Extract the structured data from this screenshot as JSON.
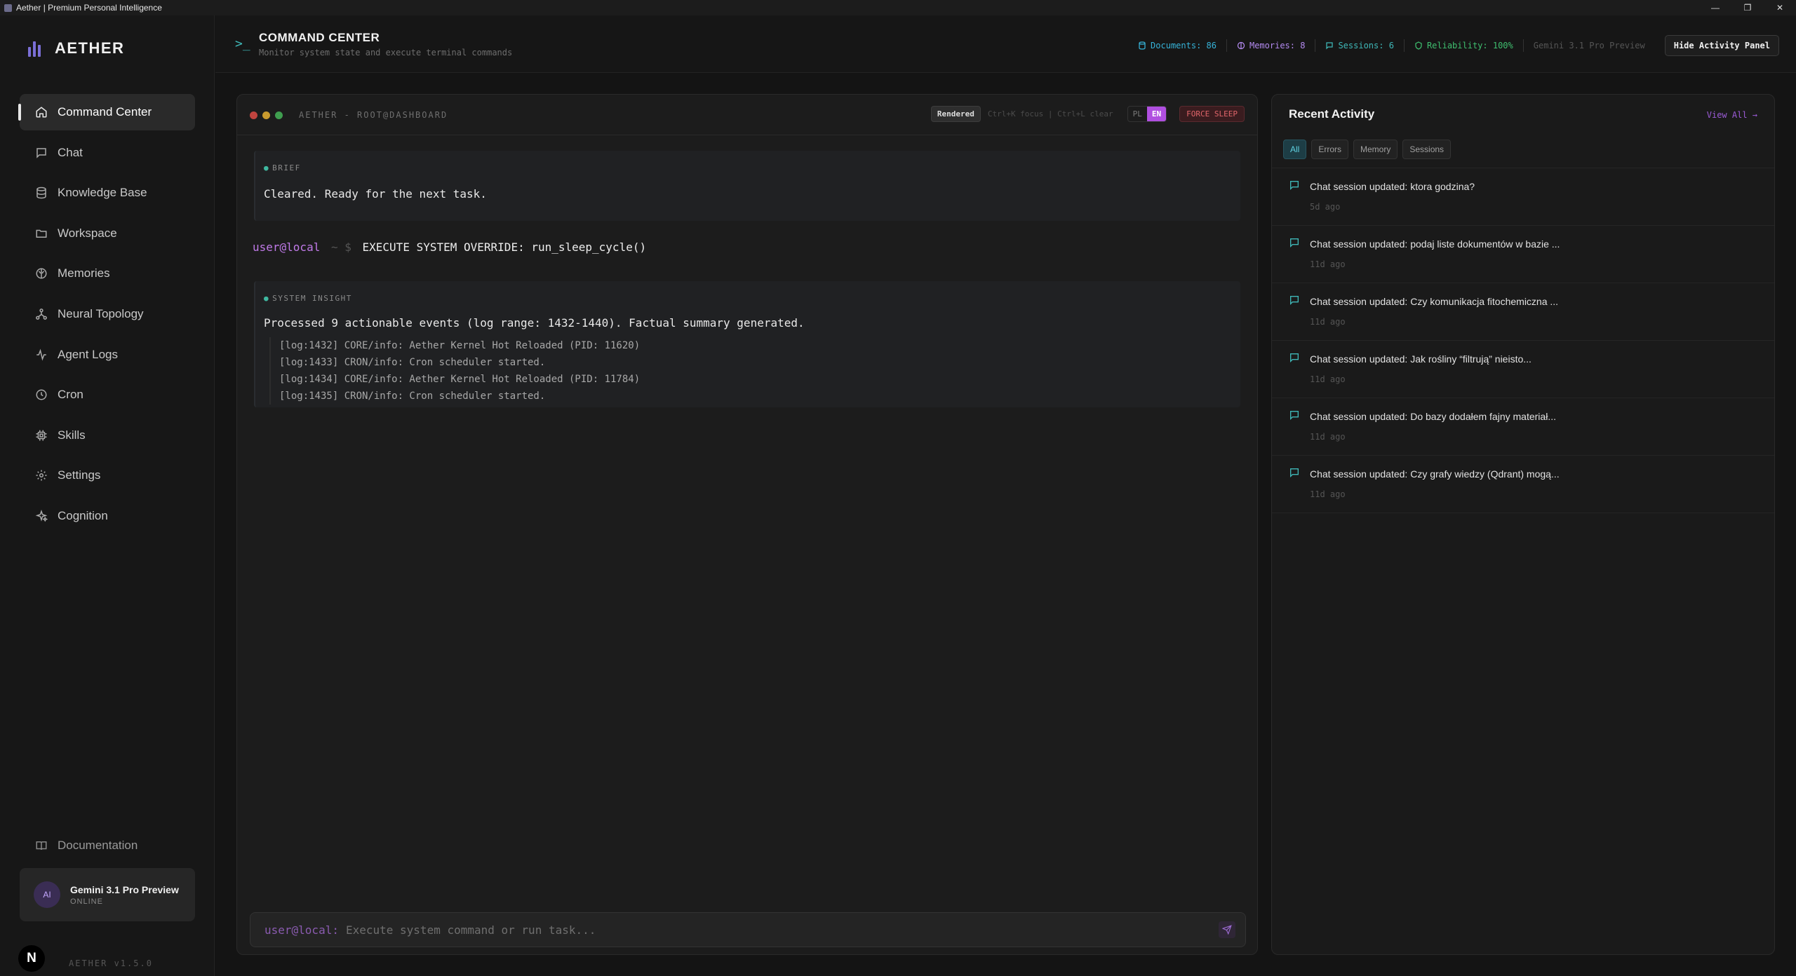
{
  "window": {
    "title": "Aether | Premium Personal Intelligence"
  },
  "brand": {
    "name": "AETHER"
  },
  "sidebar": {
    "items": [
      {
        "label": "Command Center",
        "icon": "home-icon",
        "active": true
      },
      {
        "label": "Chat",
        "icon": "chat-icon"
      },
      {
        "label": "Knowledge Base",
        "icon": "database-icon"
      },
      {
        "label": "Workspace",
        "icon": "folder-icon"
      },
      {
        "label": "Memories",
        "icon": "brain-icon"
      },
      {
        "label": "Neural Topology",
        "icon": "network-icon"
      },
      {
        "label": "Agent Logs",
        "icon": "activity-icon"
      },
      {
        "label": "Cron",
        "icon": "clock-icon"
      },
      {
        "label": "Skills",
        "icon": "cpu-icon"
      },
      {
        "label": "Settings",
        "icon": "gear-icon"
      },
      {
        "label": "Cognition",
        "icon": "sparkles-icon"
      }
    ],
    "documentation": "Documentation",
    "model": {
      "avatar": "AI",
      "name": "Gemini 3.1 Pro Preview",
      "status": "ONLINE"
    },
    "version": "AETHER v1.5.0"
  },
  "header": {
    "title": "COMMAND CENTER",
    "subtitle": "Monitor system state and execute terminal commands",
    "stats": {
      "documents": "Documents: 86",
      "memories": "Memories: 8",
      "sessions": "Sessions: 6",
      "reliability": "Reliability: 100%",
      "model": "Gemini 3.1 Pro Preview"
    },
    "hide_button": "Hide Activity Panel"
  },
  "terminal": {
    "label": "AETHER - ROOT@DASHBOARD",
    "rendered_button": "Rendered",
    "shortcuts": "Ctrl+K focus | Ctrl+L clear",
    "lang_pl": "PL",
    "lang_en": "EN",
    "force_sleep": "FORCE SLEEP",
    "brief": {
      "tag": "BRIEF",
      "text": "Cleared. Ready for the next task."
    },
    "command": {
      "user": "user@local",
      "sep": "~ $",
      "text": "EXECUTE SYSTEM OVERRIDE: run_sleep_cycle()"
    },
    "insight": {
      "tag": "SYSTEM INSIGHT",
      "text": "Processed 9 actionable events (log range: 1432-1440). Factual summary generated.",
      "logs": [
        "[log:1432] CORE/info: Aether Kernel Hot Reloaded (PID: 11620)",
        "[log:1433] CRON/info: Cron scheduler started.",
        "[log:1434] CORE/info: Aether Kernel Hot Reloaded (PID: 11784)",
        "[log:1435] CRON/info: Cron scheduler started."
      ]
    },
    "input": {
      "prompt": "user@local:",
      "placeholder": "Execute system command or run task..."
    }
  },
  "activity": {
    "title": "Recent Activity",
    "view_all": "View All →",
    "filters": [
      "All",
      "Errors",
      "Memory",
      "Sessions"
    ],
    "items": [
      {
        "text": "Chat session updated: ktora godzina?",
        "time": "5d ago"
      },
      {
        "text": "Chat session updated: podaj liste dokumentów w bazie ...",
        "time": "11d ago"
      },
      {
        "text": "Chat session updated: Czy komunikacja fitochemiczna ...",
        "time": "11d ago"
      },
      {
        "text": "Chat session updated: Jak rośliny “filtrują” nieisto...",
        "time": "11d ago"
      },
      {
        "text": "Chat session updated: Do bazy dodałem fajny materiał...",
        "time": "11d ago"
      },
      {
        "text": "Chat session updated: Czy grafy wiedzy (Qdrant) mogą...",
        "time": "11d ago"
      }
    ]
  },
  "colors": {
    "accent_purple": "#b04fe0",
    "teal": "#3fb8b8",
    "danger": "#e0656a",
    "success": "#3fbf6f"
  }
}
